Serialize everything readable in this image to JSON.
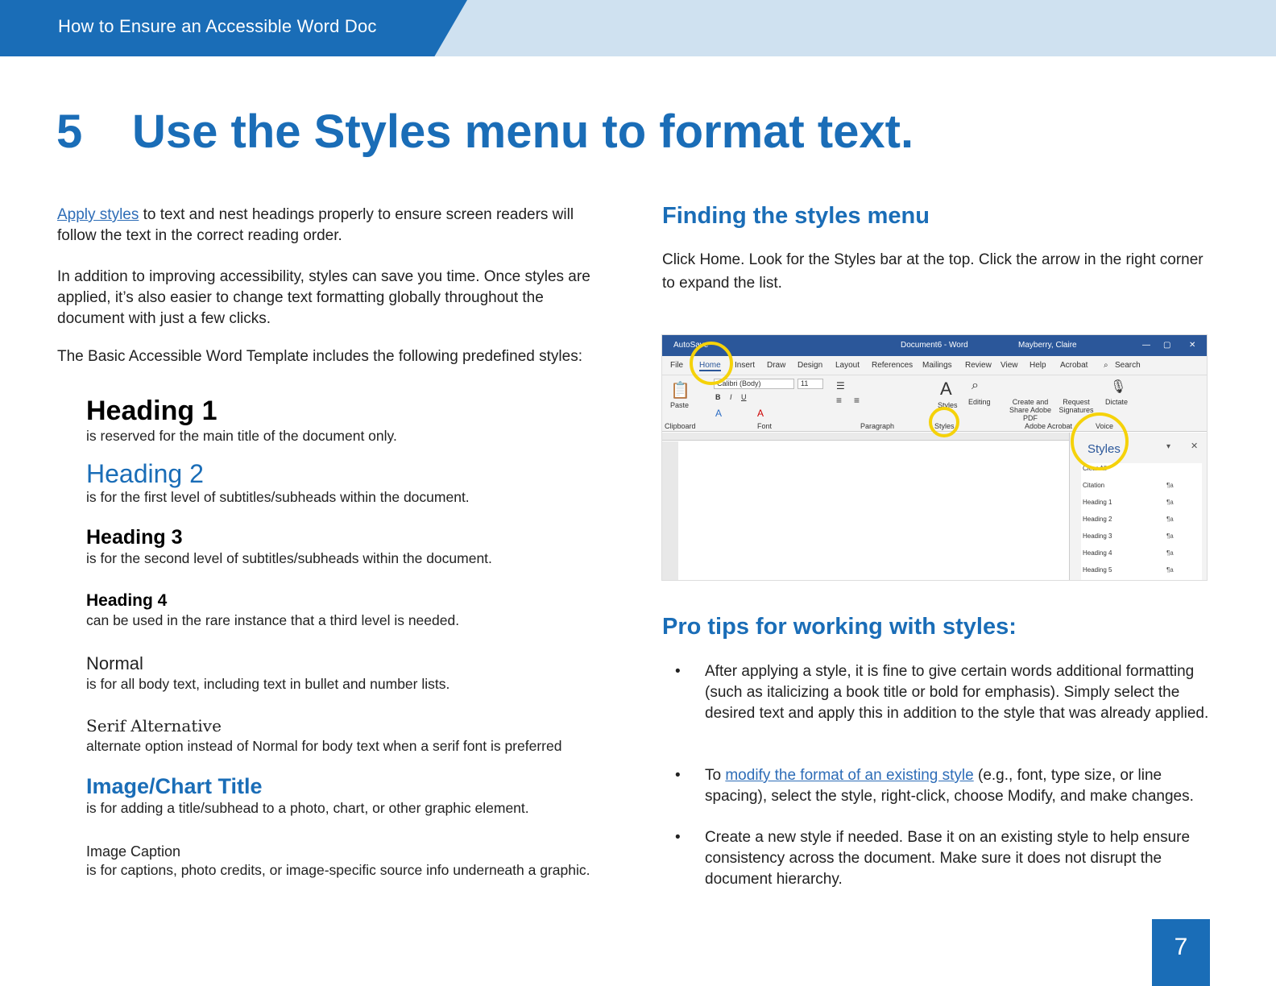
{
  "header": {
    "title": "How to Ensure an Accessible Word Doc"
  },
  "main": {
    "number": "5",
    "title": "Use the Styles menu to format text."
  },
  "left": {
    "intro_link": "Apply styles",
    "intro_rest": " to text and nest headings properly to ensure screen readers will follow the text in the correct reading order.",
    "para2": "In addition to improving accessibility, styles can save you time. Once styles are applied, it’s also easier to change text formatting globally throughout the document with just a few clicks.",
    "para3": "The Basic Accessible Word Template includes the following predefined styles:",
    "styles": [
      {
        "name": "Heading 1",
        "desc": "is reserved for the main title of the document only."
      },
      {
        "name": "Heading 2",
        "desc": "is for the first level of subtitles/subheads within the document."
      },
      {
        "name": "Heading 3",
        "desc": "is for the second level of subtitles/subheads within the document."
      },
      {
        "name": "Heading 4",
        "desc": "can be used in the rare instance that a third level is needed."
      },
      {
        "name": "Normal",
        "desc": "is for all body text, including text in bullet and number lists."
      },
      {
        "name": "Serif Alternative",
        "desc": "alternate option instead of Normal for body text when a serif font is preferred"
      },
      {
        "name": "Image/Chart Title",
        "desc": "is for adding a title/subhead to a photo, chart, or other graphic element."
      },
      {
        "name": "Image Caption",
        "desc": "is for captions, photo credits, or image-specific source info underneath a graphic."
      }
    ]
  },
  "right": {
    "finding_heading": "Finding the styles menu",
    "finding_text": "Click Home. Look for the Styles bar at the top. Click the arrow in the right corner to expand the list.",
    "protips_heading": "Pro tips for working with styles:",
    "bullets": [
      {
        "text": "After applying a style, it is fine to give certain words additional formatting (such as italicizing a book title or bold for emphasis). Simply select the desired text and apply this in addition to the style that was already applied."
      },
      {
        "pre": "To ",
        "link": "modify the format of an existing style",
        "post": " (e.g., font, type size, or line spacing), select the style, right-click, choose Modify, and make changes."
      },
      {
        "text": "Create a new style if needed. Base it on an existing style to help ensure consistency across the document. Make sure it does not disrupt the document hierarchy."
      }
    ],
    "bullet_char": "•"
  },
  "screenshot": {
    "titlebar": {
      "autosave": "AutoSave",
      "doc": "Document6 - Word",
      "user": "Mayberry, Claire"
    },
    "tabs": [
      "File",
      "Home",
      "Insert",
      "Draw",
      "Design",
      "Layout",
      "References",
      "Mailings",
      "Review",
      "View",
      "Help",
      "Acrobat",
      "Search"
    ],
    "ribbon": {
      "paste": "Paste",
      "font_name": "Calibri (Body)",
      "font_size": "11",
      "styles": "Styles",
      "editing": "Editing",
      "create_pdf": "Create and Share Adobe PDF",
      "request_sig": "Request Signatures",
      "dictate": "Dictate",
      "groups": [
        "Clipboard",
        "Font",
        "Paragraph",
        "Styles",
        "Adobe Acrobat",
        "Voice"
      ]
    },
    "pane": {
      "title": "Styles",
      "items": [
        "Clear All",
        "Citation",
        "Heading 1",
        "Heading 2",
        "Heading 3",
        "Heading 4",
        "Heading 5"
      ],
      "marker": "¶a"
    }
  },
  "page_number": "7"
}
